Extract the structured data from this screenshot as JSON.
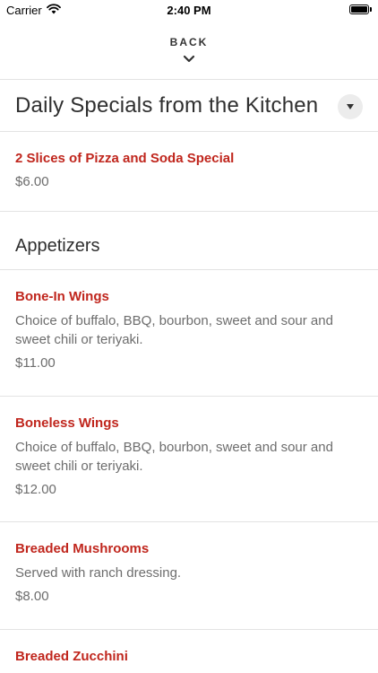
{
  "status_bar": {
    "carrier": "Carrier",
    "time": "2:40 PM"
  },
  "nav": {
    "back_label": "BACK"
  },
  "daily_specials": {
    "title": "Daily Specials from the Kitchen",
    "items": [
      {
        "name": "2 Slices of Pizza and Soda Special",
        "price": "$6.00"
      }
    ]
  },
  "appetizers": {
    "title": "Appetizers",
    "items": [
      {
        "name": "Bone-In Wings",
        "description": "Choice of buffalo, BBQ, bourbon, sweet and sour and sweet chili or teriyaki.",
        "price": "$11.00"
      },
      {
        "name": "Boneless Wings",
        "description": "Choice of buffalo, BBQ, bourbon, sweet and sour and sweet chili or teriyaki.",
        "price": "$12.00"
      },
      {
        "name": "Breaded Mushrooms",
        "description": "Served with ranch dressing.",
        "price": "$8.00"
      },
      {
        "name": "Breaded Zucchini"
      }
    ]
  },
  "colors": {
    "item_name": "#c0261d",
    "secondary_text": "#6d6d6d",
    "divider": "#e3e3e3",
    "toggle_bg": "#ececec"
  },
  "icons": {
    "wifi": "wifi-icon",
    "battery": "battery-icon",
    "back": "chevron-down-icon",
    "collapse": "caret-down-icon"
  }
}
